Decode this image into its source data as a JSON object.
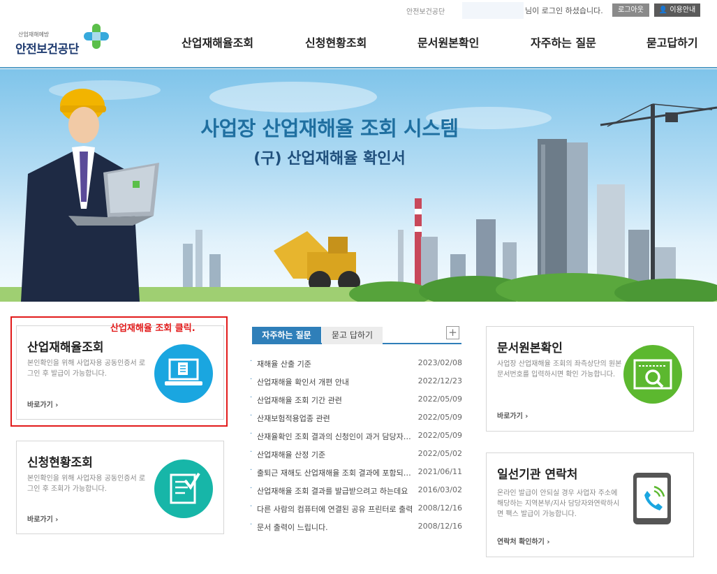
{
  "topbar": {
    "org": "안전보건공단",
    "greeting": "님이 로그인 하셨습니다.",
    "logout_label": "로그아웃",
    "guide_label": "이용안내"
  },
  "logo": {
    "tagline": "산업재해예방",
    "name": "안전보건공단"
  },
  "nav": {
    "items": [
      {
        "label": "산업재해율조회"
      },
      {
        "label": "신청현황조회"
      },
      {
        "label": "문서원본확인"
      },
      {
        "label": "자주하는 질문"
      },
      {
        "label": "묻고답하기"
      }
    ]
  },
  "hero": {
    "title": "사업장 산업재해율 조회 시스템",
    "subtitle": "(구) 산업재해율 확인서"
  },
  "annotation": {
    "note": "산업재해율 조회 클릭."
  },
  "cards": {
    "rate": {
      "title": "산업재해율조회",
      "desc": "본인확인을 위해 사업자용 공동인증서 로그인 후 발급이 가능합니다.",
      "link": "바로가기 ›"
    },
    "status": {
      "title": "신청현황조회",
      "desc": "본인확인을 위해 사업자용 공동인증서 로그인 후 조회가 가능합니다.",
      "link": "바로가기 ›"
    },
    "doc": {
      "title": "문서원본확인",
      "desc": "사업장 산업재해율 조회의 좌측상단의 원본문서번호를 입력하시면 확인 가능합니다.",
      "link": "바로가기 ›"
    },
    "contact": {
      "title": "일선기관 연락처",
      "desc": "온라인 발급이 안되실 경우 사업자 주소에 해당하는 지역본부/지사 담당자와연락하시면 팩스 발급이 가능합니다.",
      "link": "연락처 확인하기 ›"
    }
  },
  "board": {
    "tab_faq": "자주하는 질문",
    "tab_qna": "묻고 답하기",
    "more": "+",
    "bullet": "·",
    "items": [
      {
        "title": "재해율 산출 기준",
        "date": "2023/02/08"
      },
      {
        "title": "산업재해율 확인서 개편 안내",
        "date": "2022/12/23"
      },
      {
        "title": "산업재해율 조회 기간 관련",
        "date": "2022/05/09"
      },
      {
        "title": "산재보험적용업종 관련",
        "date": "2022/05/09"
      },
      {
        "title": "산재율확인 조회 결과의 신청인이 과거 담당자로 나와요",
        "date": "2022/05/09"
      },
      {
        "title": "산업재해율 산정 기준",
        "date": "2022/05/02"
      },
      {
        "title": "출퇴근 재해도 산업재해율 조회 결과에 포함되나요",
        "date": "2021/06/11"
      },
      {
        "title": "산업재해율 조회 결과를 발급받으려고 하는데요",
        "date": "2016/03/02"
      },
      {
        "title": "다른 사람의 컴퓨터에 연결된 공유 프린터로 출력",
        "date": "2008/12/16"
      },
      {
        "title": "문서 출력이 느립니다.",
        "date": "2008/12/16"
      }
    ]
  },
  "colors": {
    "accent_blue": "#2f7fb9",
    "rate_circle": "#1aa6e0",
    "status_circle": "#17b6a8",
    "doc_circle": "#5cb82f",
    "highlight_red": "#e21b1b"
  }
}
